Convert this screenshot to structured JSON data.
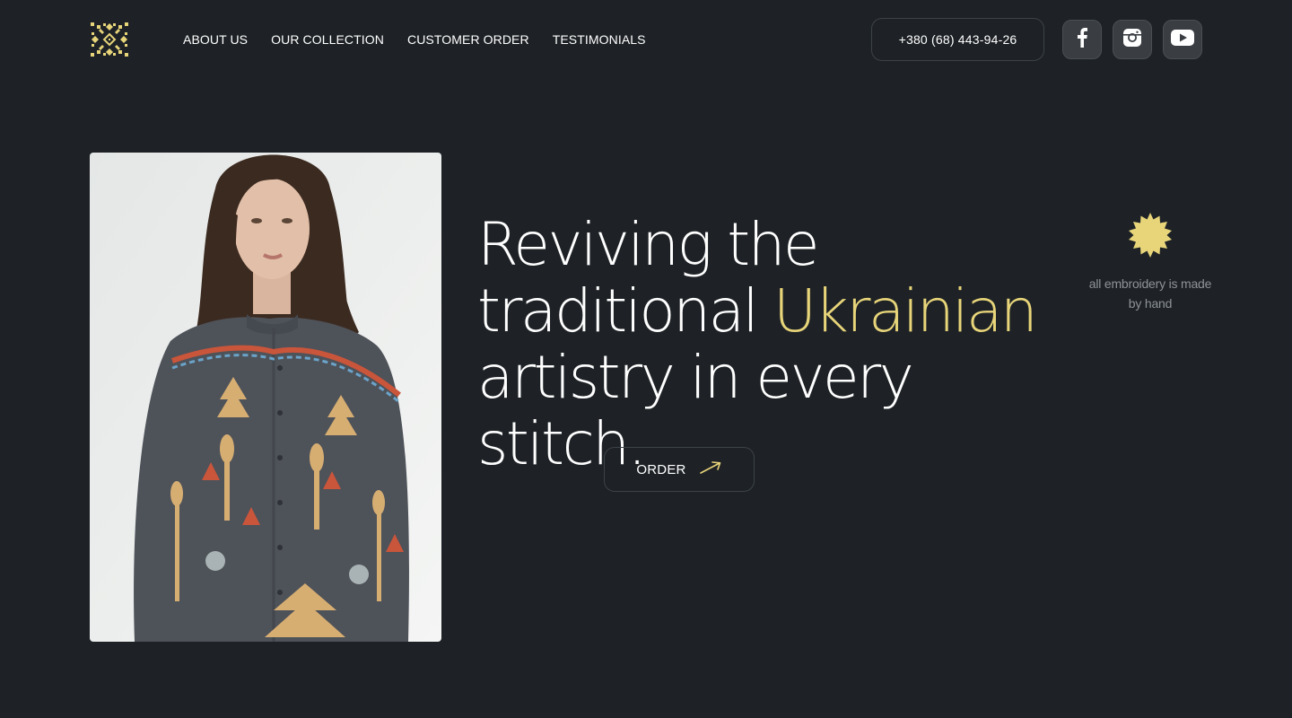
{
  "brand": {
    "logo_icon": "embroidery-ornament-icon",
    "accent_color": "#e8d57a"
  },
  "nav": {
    "items": [
      {
        "label": "ABOUT US"
      },
      {
        "label": "OUR COLLECTION"
      },
      {
        "label": "CUSTOMER ORDER"
      },
      {
        "label": "TESTIMONIALS"
      }
    ]
  },
  "contact": {
    "phone": "+380 (68) 443-94-26"
  },
  "social": [
    {
      "icon": "facebook-icon"
    },
    {
      "icon": "instagram-icon"
    },
    {
      "icon": "youtube-icon"
    }
  ],
  "hero": {
    "headline_part1": "Reviving the traditional ",
    "headline_accent": "Ukrainian",
    "headline_part2": " artistry in every stitch.",
    "order_label": "ORDER",
    "image_alt": "woman-in-embroidered-shirt-photo"
  },
  "badge": {
    "text": "all embroidery is made by hand"
  }
}
